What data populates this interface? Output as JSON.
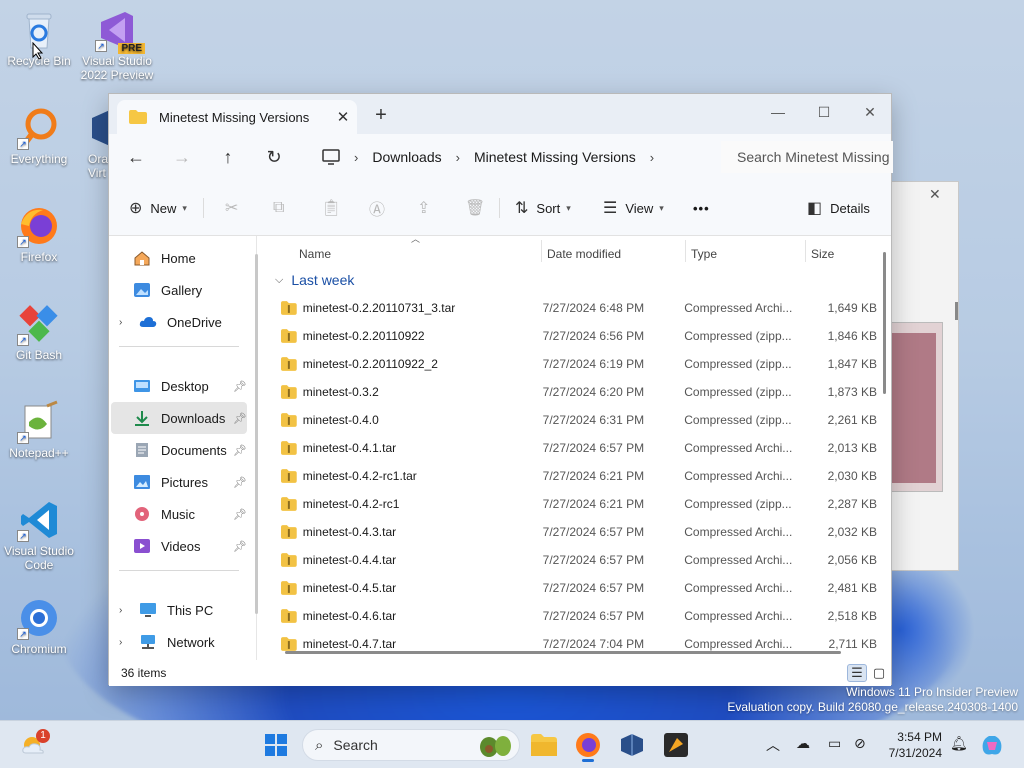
{
  "desktop": {
    "icons": [
      {
        "label": "Recycle Bin",
        "icon": "recycle-bin-icon"
      },
      {
        "label": "Visual Studio 2022 Preview",
        "icon": "visual-studio-icon",
        "badge": "PRE"
      },
      {
        "label": "Everything",
        "icon": "everything-icon"
      },
      {
        "label": "Ora Virt",
        "icon": "virtualbox-icon"
      },
      {
        "label": "Firefox",
        "icon": "firefox-icon"
      },
      {
        "label": "Git Bash",
        "icon": "git-bash-icon"
      },
      {
        "label": "Notepad++",
        "icon": "notepadpp-icon"
      },
      {
        "label": "Visual Studio Code",
        "icon": "vscode-icon"
      },
      {
        "label": "Chromium",
        "icon": "chromium-icon"
      }
    ]
  },
  "window": {
    "tab_title": "Minetest Missing Versions",
    "new_tab": "+",
    "controls": {
      "minimize": "—",
      "maximize": "☐",
      "close": "✕"
    }
  },
  "nav": {
    "breadcrumbs": [
      "Downloads",
      "Minetest Missing Versions"
    ],
    "search_placeholder": "Search Minetest Missing Versions"
  },
  "toolbar": {
    "new_label": "New",
    "sort_label": "Sort",
    "view_label": "View",
    "more_label": "•••",
    "details_label": "Details"
  },
  "sidebar": {
    "top": [
      {
        "label": "Home"
      },
      {
        "label": "Gallery"
      },
      {
        "label": "OneDrive"
      }
    ],
    "pinned": [
      {
        "label": "Desktop"
      },
      {
        "label": "Downloads"
      },
      {
        "label": "Documents"
      },
      {
        "label": "Pictures"
      },
      {
        "label": "Music"
      },
      {
        "label": "Videos"
      }
    ],
    "bottom": [
      {
        "label": "This PC"
      },
      {
        "label": "Network"
      }
    ]
  },
  "files": {
    "columns": {
      "name": "Name",
      "date": "Date modified",
      "type": "Type",
      "size": "Size"
    },
    "group": "Last week",
    "rows": [
      {
        "name": "minetest-0.2.20110731_3.tar",
        "date": "7/27/2024 6:48 PM",
        "type": "Compressed Archi...",
        "size": "1,649 KB"
      },
      {
        "name": "minetest-0.2.20110922",
        "date": "7/27/2024 6:56 PM",
        "type": "Compressed (zipp...",
        "size": "1,846 KB"
      },
      {
        "name": "minetest-0.2.20110922_2",
        "date": "7/27/2024 6:19 PM",
        "type": "Compressed (zipp...",
        "size": "1,847 KB"
      },
      {
        "name": "minetest-0.3.2",
        "date": "7/27/2024 6:20 PM",
        "type": "Compressed (zipp...",
        "size": "1,873 KB"
      },
      {
        "name": "minetest-0.4.0",
        "date": "7/27/2024 6:31 PM",
        "type": "Compressed (zipp...",
        "size": "2,261 KB"
      },
      {
        "name": "minetest-0.4.1.tar",
        "date": "7/27/2024 6:57 PM",
        "type": "Compressed Archi...",
        "size": "2,013 KB"
      },
      {
        "name": "minetest-0.4.2-rc1.tar",
        "date": "7/27/2024 6:21 PM",
        "type": "Compressed Archi...",
        "size": "2,030 KB"
      },
      {
        "name": "minetest-0.4.2-rc1",
        "date": "7/27/2024 6:21 PM",
        "type": "Compressed (zipp...",
        "size": "2,287 KB"
      },
      {
        "name": "minetest-0.4.3.tar",
        "date": "7/27/2024 6:57 PM",
        "type": "Compressed Archi...",
        "size": "2,032 KB"
      },
      {
        "name": "minetest-0.4.4.tar",
        "date": "7/27/2024 6:57 PM",
        "type": "Compressed Archi...",
        "size": "2,056 KB"
      },
      {
        "name": "minetest-0.4.5.tar",
        "date": "7/27/2024 6:57 PM",
        "type": "Compressed Archi...",
        "size": "2,481 KB"
      },
      {
        "name": "minetest-0.4.6.tar",
        "date": "7/27/2024 6:57 PM",
        "type": "Compressed Archi...",
        "size": "2,518 KB"
      },
      {
        "name": "minetest-0.4.7.tar",
        "date": "7/27/2024 7:04 PM",
        "type": "Compressed Archi...",
        "size": "2,711 KB"
      }
    ]
  },
  "status": {
    "item_count": "36 items"
  },
  "watermark": {
    "line1": "Windows 11 Pro Insider Preview",
    "line2": "Evaluation copy. Build 26080.ge_release.240308-1400"
  },
  "taskbar": {
    "search_placeholder": "Search",
    "weather_badge": "1",
    "time": "3:54 PM",
    "date": "7/31/2024"
  }
}
